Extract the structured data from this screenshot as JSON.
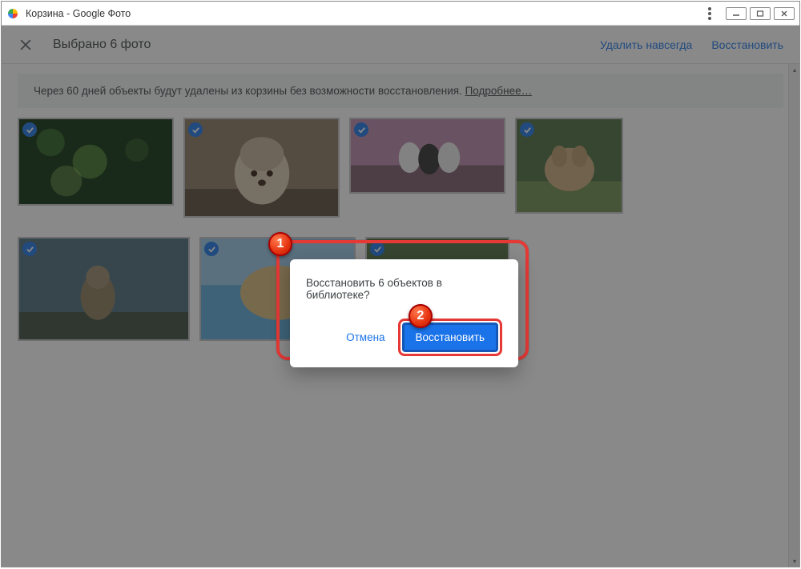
{
  "window": {
    "title": "Корзина - Google Фото"
  },
  "actionbar": {
    "selection": "Выбрано 6 фото",
    "delete_forever": "Удалить навсегда",
    "restore": "Восстановить"
  },
  "info": {
    "text": "Через 60 дней объекты будут удалены из корзины без возможности восстановления. ",
    "link": "Подробнее…"
  },
  "dialog": {
    "message": "Восстановить 6 объектов в библиотеке?",
    "cancel": "Отмена",
    "restore": "Восстановить"
  },
  "steps": {
    "s1": "1",
    "s2": "2"
  },
  "photos": {
    "count": 7,
    "all_selected": true
  }
}
